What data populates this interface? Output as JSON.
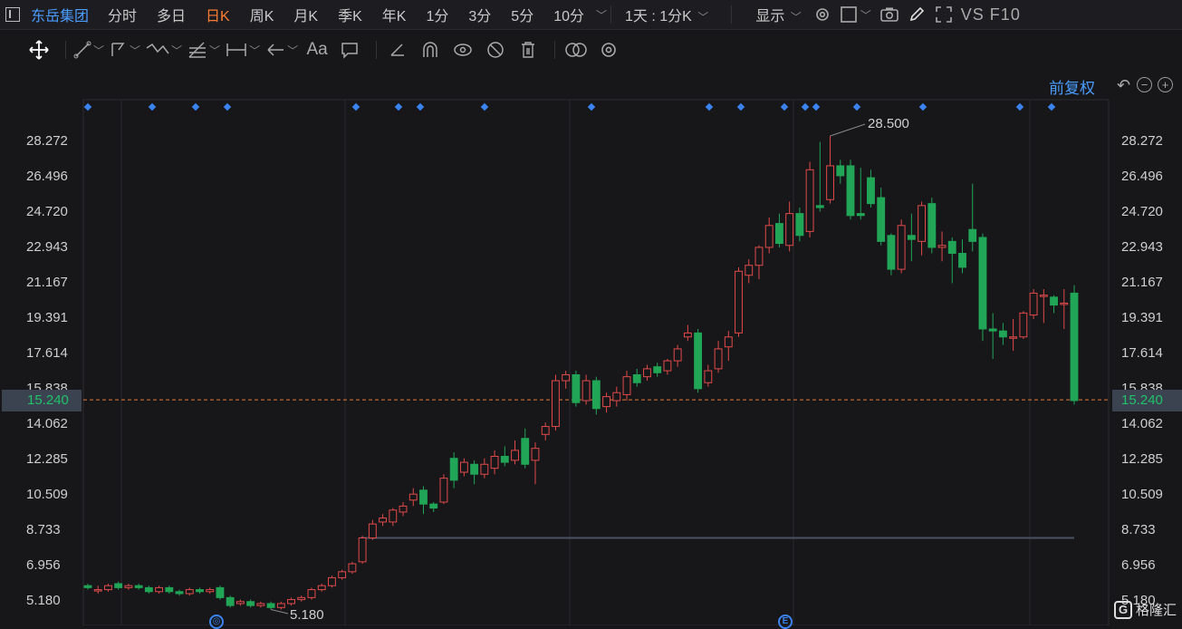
{
  "header": {
    "stock_name": "东岳集团",
    "periods": [
      "分时",
      "多日",
      "日K",
      "周K",
      "月K",
      "季K",
      "年K",
      "1分",
      "3分",
      "5分",
      "10分"
    ],
    "active_period": "日K",
    "interval_select": "1天 : 1分K",
    "display_label": "显示",
    "vs_f10": "VS F10"
  },
  "toolbar": {
    "text_tool": "Aa"
  },
  "chart_header": {
    "fuquan": "前复权"
  },
  "axis": {
    "labels": [
      "28.272",
      "26.496",
      "24.720",
      "22.943",
      "21.167",
      "19.391",
      "17.614",
      "15.838",
      "14.062",
      "12.285",
      "10.509",
      "8.733",
      "6.956",
      "5.180"
    ],
    "current_price": "15.240"
  },
  "annotations": {
    "high": "28.500",
    "low": "5.180"
  },
  "badges": {
    "b1": "◎",
    "b2": "E"
  },
  "watermark": {
    "text": "格隆汇"
  },
  "colors": {
    "up": "#e04a4a",
    "down": "#21a557",
    "accent": "#ff7d30",
    "link": "#4a9cff",
    "price_line": "#e57c3a"
  },
  "chart_data": {
    "type": "candlestick",
    "y_range": [
      5.18,
      28.272
    ],
    "high": 28.5,
    "low": 5.18,
    "current": 15.24,
    "horizontal_level": 8.3,
    "candles": [
      [
        5.9,
        5.8,
        6.0,
        5.7
      ],
      [
        5.7,
        5.7,
        5.9,
        5.5
      ],
      [
        5.7,
        5.9,
        6.0,
        5.6
      ],
      [
        6.0,
        5.8,
        6.1,
        5.7
      ],
      [
        5.8,
        5.9,
        6.0,
        5.7
      ],
      [
        5.9,
        5.8,
        6.0,
        5.7
      ],
      [
        5.8,
        5.6,
        5.9,
        5.5
      ],
      [
        5.6,
        5.8,
        5.9,
        5.5
      ],
      [
        5.8,
        5.6,
        5.9,
        5.5
      ],
      [
        5.6,
        5.5,
        5.7,
        5.4
      ],
      [
        5.5,
        5.7,
        5.8,
        5.4
      ],
      [
        5.7,
        5.6,
        5.8,
        5.5
      ],
      [
        5.6,
        5.7,
        5.8,
        5.5
      ],
      [
        5.8,
        5.3,
        5.9,
        5.2
      ],
      [
        5.3,
        4.9,
        5.4,
        4.8
      ],
      [
        5.0,
        5.1,
        5.2,
        4.9
      ],
      [
        5.1,
        4.9,
        5.2,
        4.8
      ],
      [
        4.9,
        5.0,
        5.1,
        4.8
      ],
      [
        5.0,
        4.8,
        5.1,
        4.7
      ],
      [
        4.8,
        5.0,
        5.1,
        4.7
      ],
      [
        5.0,
        5.2,
        5.3,
        4.9
      ],
      [
        5.2,
        5.3,
        5.4,
        5.1
      ],
      [
        5.3,
        5.7,
        5.8,
        5.2
      ],
      [
        5.7,
        5.9,
        6.0,
        5.6
      ],
      [
        5.9,
        6.3,
        6.4,
        5.8
      ],
      [
        6.3,
        6.6,
        6.7,
        6.2
      ],
      [
        6.6,
        7.0,
        7.1,
        6.5
      ],
      [
        7.1,
        8.3,
        8.4,
        7.0
      ],
      [
        8.3,
        9.0,
        9.2,
        8.2
      ],
      [
        9.1,
        9.3,
        9.5,
        8.9
      ],
      [
        9.1,
        9.7,
        9.8,
        8.9
      ],
      [
        9.6,
        9.9,
        10.1,
        9.4
      ],
      [
        10.2,
        10.5,
        10.8,
        9.9
      ],
      [
        10.7,
        10.0,
        10.9,
        9.5
      ],
      [
        10.0,
        9.8,
        10.1,
        9.6
      ],
      [
        10.1,
        11.3,
        11.5,
        10.0
      ],
      [
        12.3,
        11.2,
        12.6,
        10.8
      ],
      [
        11.6,
        12.1,
        12.3,
        11.4
      ],
      [
        12.0,
        11.5,
        12.2,
        11.0
      ],
      [
        11.5,
        12.0,
        12.3,
        11.3
      ],
      [
        11.8,
        12.4,
        12.7,
        11.5
      ],
      [
        12.4,
        12.1,
        12.9,
        11.9
      ],
      [
        12.2,
        12.7,
        13.2,
        12.0
      ],
      [
        13.3,
        12.0,
        13.8,
        11.8
      ],
      [
        12.2,
        12.8,
        13.1,
        11.0
      ],
      [
        13.5,
        13.9,
        14.1,
        13.2
      ],
      [
        13.9,
        16.2,
        16.5,
        13.7
      ],
      [
        16.2,
        16.5,
        16.7,
        15.8
      ],
      [
        16.5,
        15.1,
        16.7,
        14.9
      ],
      [
        15.2,
        16.2,
        16.5,
        15.0
      ],
      [
        16.2,
        14.8,
        16.4,
        14.5
      ],
      [
        14.9,
        15.4,
        15.6,
        14.6
      ],
      [
        15.2,
        15.6,
        15.9,
        14.9
      ],
      [
        15.5,
        16.4,
        16.7,
        15.2
      ],
      [
        16.5,
        16.1,
        16.8,
        15.9
      ],
      [
        16.4,
        16.8,
        17.0,
        16.2
      ],
      [
        16.9,
        16.6,
        17.1,
        16.4
      ],
      [
        16.7,
        17.2,
        17.3,
        16.5
      ],
      [
        17.2,
        17.8,
        18.0,
        16.9
      ],
      [
        18.4,
        18.6,
        19.0,
        18.2
      ],
      [
        18.6,
        15.8,
        18.8,
        15.6
      ],
      [
        16.1,
        16.7,
        17.0,
        15.9
      ],
      [
        16.8,
        17.8,
        18.2,
        16.6
      ],
      [
        17.9,
        18.4,
        18.7,
        17.2
      ],
      [
        18.6,
        21.7,
        21.9,
        18.4
      ],
      [
        21.5,
        22.0,
        22.3,
        21.1
      ],
      [
        22.0,
        22.9,
        23.0,
        21.3
      ],
      [
        22.9,
        24.0,
        24.4,
        22.6
      ],
      [
        24.1,
        23.1,
        24.6,
        22.9
      ],
      [
        23.0,
        24.6,
        25.2,
        22.7
      ],
      [
        24.6,
        23.5,
        24.9,
        23.2
      ],
      [
        23.7,
        26.8,
        27.2,
        23.4
      ],
      [
        25.0,
        24.9,
        28.2,
        24.7
      ],
      [
        25.3,
        27.0,
        28.5,
        25.1
      ],
      [
        27.0,
        26.5,
        27.3,
        26.1
      ],
      [
        27.0,
        24.5,
        27.3,
        24.3
      ],
      [
        24.6,
        24.5,
        26.9,
        24.3
      ],
      [
        26.4,
        25.1,
        26.8,
        24.9
      ],
      [
        25.4,
        23.2,
        25.9,
        23.0
      ],
      [
        23.5,
        21.8,
        23.6,
        21.5
      ],
      [
        21.8,
        24.0,
        24.3,
        21.6
      ],
      [
        23.5,
        23.3,
        24.6,
        22.2
      ],
      [
        23.2,
        25.0,
        25.2,
        22.5
      ],
      [
        25.1,
        22.9,
        25.4,
        22.6
      ],
      [
        22.9,
        23.0,
        23.7,
        22.2
      ],
      [
        23.2,
        22.6,
        23.4,
        21.1
      ],
      [
        22.6,
        21.9,
        23.3,
        21.6
      ],
      [
        23.8,
        23.2,
        26.1,
        22.7
      ],
      [
        23.4,
        18.8,
        23.6,
        18.2
      ],
      [
        18.8,
        18.7,
        19.6,
        17.3
      ],
      [
        18.7,
        18.4,
        19.1,
        18.0
      ],
      [
        18.4,
        18.4,
        19.3,
        17.7
      ],
      [
        18.4,
        19.6,
        19.7,
        18.3
      ],
      [
        19.5,
        20.6,
        20.8,
        19.3
      ],
      [
        20.5,
        20.5,
        20.8,
        19.1
      ],
      [
        20.4,
        20.0,
        20.5,
        19.6
      ],
      [
        20.1,
        20.1,
        20.8,
        18.8
      ],
      [
        20.6,
        15.2,
        21.0,
        15.0
      ]
    ]
  }
}
